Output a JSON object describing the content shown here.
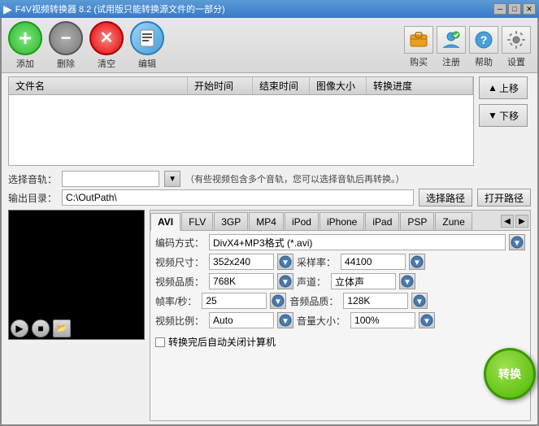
{
  "titleBar": {
    "icon": "▶",
    "text": "F4V视频转换器 8.2 (试用版只能转换源文件的一部分)",
    "minBtn": "─",
    "maxBtn": "□",
    "closeBtn": "✕"
  },
  "toolbar": {
    "addLabel": "添加",
    "deleteLabel": "删除",
    "clearLabel": "清空",
    "editLabel": "编辑",
    "buyLabel": "购买",
    "registerLabel": "注册",
    "helpLabel": "帮助",
    "settingsLabel": "设置"
  },
  "fileList": {
    "colName": "文件名",
    "colStart": "开始时间",
    "colEnd": "结束时间",
    "colSize": "图像大小",
    "colProgress": "转换进度"
  },
  "sideButtons": {
    "up": "▲ 上移",
    "down": "▼ 下移"
  },
  "audioTrack": {
    "label": "选择音轨：",
    "hint": "（有些视频包含多个音轨，您可以选择音轨后再转换。）"
  },
  "outputDir": {
    "label": "输出目录：",
    "path": "C:\\OutPath\\",
    "selectBtn": "选择路径",
    "openBtn": "打开路径"
  },
  "tabs": [
    "AVI",
    "FLV",
    "3GP",
    "MP4",
    "iPod",
    "iPhone",
    "iPad",
    "PSP",
    "Zune"
  ],
  "activeTab": "AVI",
  "settings": {
    "encodeLabel": "编码方式：",
    "encodeValue": "DivX4+MP3格式 (*.avi)",
    "videoSizeLabel": "视频尺寸：",
    "videoSizeValue": "352x240",
    "sampleRateLabel": "采样率：",
    "sampleRateValue": "44100",
    "videoQualityLabel": "视频品质：",
    "videoQualityValue": "768K",
    "audioChannelLabel": "声道：",
    "audioChannelValue": "立体声",
    "framerateLabel": "帧率/秒：",
    "framerateValue": "25",
    "audioQualityLabel": "音频品质：",
    "audioQualityValue": "128K",
    "aspectRatioLabel": "视频比例：",
    "aspectRatioValue": "Auto",
    "volumeLabel": "音量大小：",
    "volumeValue": "100%",
    "autoShutdown": "转换完后自动关闭计算机"
  },
  "convertBtn": "转换"
}
